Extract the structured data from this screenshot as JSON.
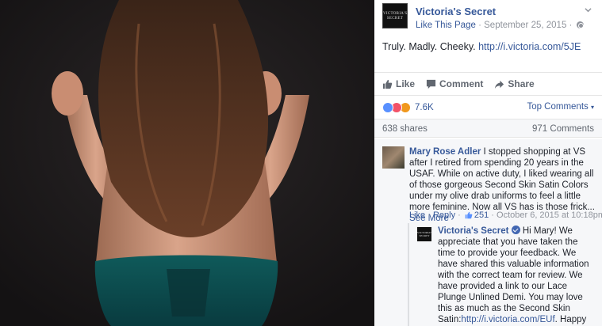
{
  "post": {
    "page_name": "Victoria's Secret",
    "like_page": "Like This Page",
    "date": "September 25, 2015",
    "separator": "·",
    "text": "Truly. Madly. Cheeky.",
    "link": "http://i.victoria.com/5JE",
    "logo_text": "VICTORIA'S SECRET"
  },
  "actions": {
    "like": "Like",
    "comment": "Comment",
    "share": "Share"
  },
  "reactions": {
    "count": "7.6K",
    "sort_label": "Top Comments",
    "types": [
      "like-icon",
      "love-icon",
      "angry-icon"
    ]
  },
  "stats": {
    "shares": "638 shares",
    "comments": "971 Comments"
  },
  "comment": {
    "author": "Mary Rose Adler",
    "text": "I stopped shopping at VS after I retired from spending 20 years in the USAF. While on active duty, I liked wearing all of those gorgeous Second Skin Satin Colors under my olive drab uniforms to feel a little more feminine. Now all VS has is those frick...",
    "see_more": "See More",
    "like": "Like",
    "reply": "Reply",
    "like_count": "251",
    "timestamp": "October 6, 2015 at 10:18pm"
  },
  "reply": {
    "author": "Victoria's Secret",
    "text_before_link": "Hi Mary! We appreciate that you have taken the time to provide your feedback. We have shared this valuable information with the correct team for review. We have provided a link to our Lace Plunge Unlined Demi. You may love this as much as the Second Skin Satin:",
    "link": "http://i.victoria.com/EUf",
    "text_after_link": ". Happy shopping!",
    "logo_text": "VICTORIA'S SECRET"
  },
  "colors": {
    "link_blue": "#365899",
    "meta_gray": "#90949c",
    "like_blue": "#5890ff",
    "love_red": "#f25268",
    "angry_orange": "#f0981d"
  }
}
